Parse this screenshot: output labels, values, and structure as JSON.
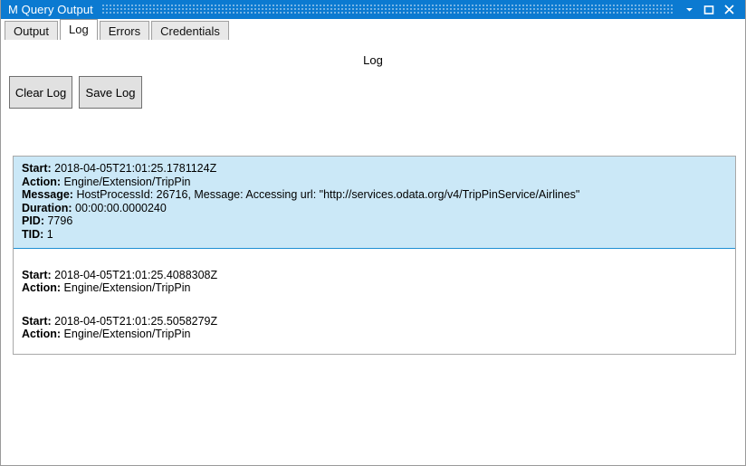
{
  "window": {
    "title": "M Query Output",
    "caption_buttons": [
      {
        "name": "minimize",
        "glyph": "chevron-down"
      },
      {
        "name": "maximize",
        "glyph": "square"
      },
      {
        "name": "close",
        "glyph": "x"
      }
    ]
  },
  "tabs": [
    {
      "label": "Output",
      "selected": false
    },
    {
      "label": "Log",
      "selected": true
    },
    {
      "label": "Errors",
      "selected": false
    },
    {
      "label": "Credentials",
      "selected": false
    }
  ],
  "page": {
    "heading": "Log",
    "buttons": {
      "clear_label": "Clear Log",
      "save_label": "Save Log"
    }
  },
  "log": {
    "entries": [
      {
        "selected": true,
        "lines": [
          {
            "key": "Start:",
            "value": "2018-04-05T21:01:25.1781124Z"
          },
          {
            "key": "Action:",
            "value": "Engine/Extension/TripPin"
          },
          {
            "key": "Message:",
            "value": "HostProcessId: 26716, Message: Accessing url: \"http://services.odata.org/v4/TripPinService/Airlines\""
          },
          {
            "key": "Duration:",
            "value": "00:00:00.0000240"
          },
          {
            "key": "PID:",
            "value": "7796"
          },
          {
            "key": "TID:",
            "value": "1"
          }
        ]
      },
      {
        "selected": false,
        "lines": [
          {
            "key": "Start:",
            "value": "2018-04-05T21:01:25.4088308Z"
          },
          {
            "key": "Action:",
            "value": "Engine/Extension/TripPin"
          }
        ]
      },
      {
        "selected": false,
        "lines": [
          {
            "key": "Start:",
            "value": "2018-04-05T21:01:25.5058279Z"
          },
          {
            "key": "Action:",
            "value": "Engine/Extension/TripPin"
          }
        ]
      }
    ]
  },
  "colors": {
    "titlebar": "#0b7ad1",
    "selection_bg": "#cbe8f7",
    "selection_border": "#1d8fd4",
    "button_face": "#e1e1e1",
    "panel_border": "#a8a8a8"
  }
}
